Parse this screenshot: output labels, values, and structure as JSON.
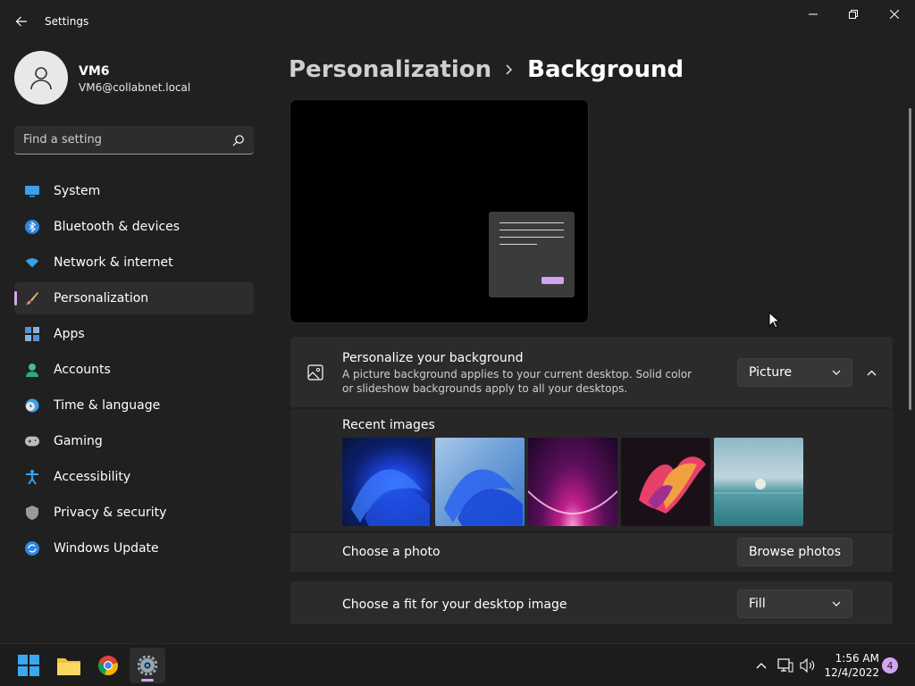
{
  "window": {
    "title": "Settings"
  },
  "user": {
    "name": "VM6",
    "email": "VM6@collabnet.local"
  },
  "search": {
    "placeholder": "Find a setting"
  },
  "sidebar": {
    "items": [
      {
        "label": "System",
        "icon": "monitor-icon"
      },
      {
        "label": "Bluetooth & devices",
        "icon": "bluetooth-icon"
      },
      {
        "label": "Network & internet",
        "icon": "wifi-icon"
      },
      {
        "label": "Personalization",
        "icon": "brush-icon",
        "active": true
      },
      {
        "label": "Apps",
        "icon": "apps-icon"
      },
      {
        "label": "Accounts",
        "icon": "person-icon"
      },
      {
        "label": "Time & language",
        "icon": "clock-globe-icon"
      },
      {
        "label": "Gaming",
        "icon": "gamepad-icon"
      },
      {
        "label": "Accessibility",
        "icon": "accessibility-icon"
      },
      {
        "label": "Privacy & security",
        "icon": "shield-icon"
      },
      {
        "label": "Windows Update",
        "icon": "update-icon"
      }
    ]
  },
  "breadcrumb": {
    "parent": "Personalization",
    "current": "Background"
  },
  "background_card": {
    "title": "Personalize your background",
    "description": "A picture background applies to your current desktop. Solid color or slideshow backgrounds apply to all your desktops.",
    "type_value": "Picture"
  },
  "recent": {
    "label": "Recent images"
  },
  "photo_row": {
    "label": "Choose a photo",
    "button": "Browse photos"
  },
  "fit_row": {
    "label": "Choose a fit for your desktop image",
    "value": "Fill"
  },
  "taskbar": {
    "time": "1:56 AM",
    "date": "12/4/2022",
    "notifications": "4"
  },
  "colors": {
    "accent": "#d3a4f3",
    "background": "#202020",
    "card": "#2b2b2b"
  }
}
